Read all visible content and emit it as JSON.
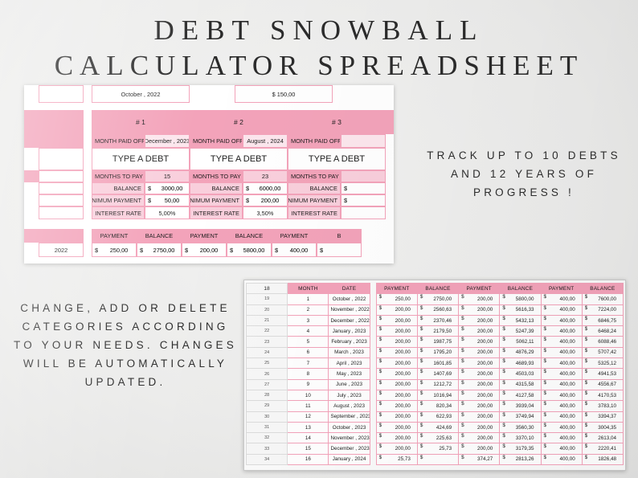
{
  "headline": {
    "line1": "DEBT SNOWBALL",
    "line2": "CALCULATOR SPREADSHEET"
  },
  "promo_right": "TRACK UP TO 10 DEBTS AND 12 YEARS OF PROGRESS !",
  "promo_left": "CHANGE, ADD OR DELETE CATEGORIES ACCORDING TO YOUR NEEDS. CHANGES WILL BE AUTOMATICALLY UPDATED.",
  "colors": {
    "pink": "#F3A3BA",
    "pink_light": "#F9CFDC",
    "pink_xlight": "#FCE6ED",
    "text": "#1D1D1D",
    "background": "#ECECEB"
  },
  "top_sheet": {
    "start_month": "October , 2022",
    "extra_payment": "$ 150,00",
    "debts": [
      {
        "number": "# 1",
        "month_paid_off_label": "MONTH PAID OFF",
        "month_paid_off": "December , 2023",
        "name": "TYPE A DEBT",
        "months_to_pay_off_label": "MONTHS TO PAY OFF",
        "months_to_pay_off": "15",
        "balance_label": "BALANCE",
        "balance": "3000,00",
        "minimum_payment_label": "MINIMUM PAYMENT",
        "minimum_payment": "50,00",
        "interest_rate_label": "INTEREST RATE",
        "interest_rate": "5,00%",
        "payment_header": "PAYMENT",
        "balance_header": "BALANCE",
        "first_payment": "250,00",
        "first_balance": "2750,00"
      },
      {
        "number": "# 2",
        "month_paid_off_label": "MONTH PAID OFF",
        "month_paid_off": "August , 2024",
        "name": "TYPE A DEBT",
        "months_to_pay_off_label": "MONTHS TO PAY OFF",
        "months_to_pay_off": "23",
        "balance_label": "BALANCE",
        "balance": "6000,00",
        "minimum_payment_label": "MINIMUM PAYMENT",
        "minimum_payment": "200,00",
        "interest_rate_label": "INTEREST RATE",
        "interest_rate": "3,50%",
        "payment_header": "PAYMENT",
        "balance_header": "BALANCE",
        "first_payment": "200,00",
        "first_balance": "5800,00"
      },
      {
        "number": "# 3",
        "month_paid_off_label": "MONTH PAID OFF",
        "month_paid_off": "",
        "name": "TYPE A DEBT",
        "months_to_pay_off_label": "MONTHS TO PAY OFF",
        "months_to_pay_off": "",
        "balance_label": "BALANCE",
        "balance": "",
        "minimum_payment_label": "MINIMUM PAYMENT",
        "minimum_payment": "",
        "interest_rate_label": "INTEREST RATE",
        "interest_rate": "",
        "payment_header": "PAYMENT",
        "balance_header": "B",
        "first_payment": "400,00",
        "first_balance": ""
      }
    ],
    "first_row_year": "2022",
    "dollar_sign": "$"
  },
  "bottom_sheet": {
    "dollar_sign": "$",
    "headers": {
      "row_num": "",
      "month": "MONTH",
      "date": "DATE",
      "payment": "PAYMENT",
      "balance": "BALANCE"
    },
    "column_groups": [
      "PAYMENT",
      "BALANCE",
      "PAYMENT",
      "BALANCE",
      "PAYMENT",
      "BALANCE"
    ],
    "header_row_num": "18",
    "rows": [
      {
        "rn": "19",
        "month": "1",
        "date": "October , 2022",
        "p1": "250,00",
        "b1": "2750,00",
        "p2": "200,00",
        "b2": "5800,00",
        "p3": "400,00",
        "b3": "7600,00"
      },
      {
        "rn": "20",
        "month": "2",
        "date": "November , 2022",
        "p1": "200,00",
        "b1": "2560,63",
        "p2": "200,00",
        "b2": "5616,33",
        "p3": "400,00",
        "b3": "7224,00"
      },
      {
        "rn": "21",
        "month": "3",
        "date": "December , 2022",
        "p1": "200,00",
        "b1": "2370,46",
        "p2": "200,00",
        "b2": "5432,13",
        "p3": "400,00",
        "b3": "6846,75"
      },
      {
        "rn": "22",
        "month": "4",
        "date": "January , 2023",
        "p1": "200,00",
        "b1": "2179,50",
        "p2": "200,00",
        "b2": "5247,39",
        "p3": "400,00",
        "b3": "6468,24"
      },
      {
        "rn": "23",
        "month": "5",
        "date": "February , 2023",
        "p1": "200,00",
        "b1": "1987,75",
        "p2": "200,00",
        "b2": "5062,11",
        "p3": "400,00",
        "b3": "6088,46"
      },
      {
        "rn": "24",
        "month": "6",
        "date": "March , 2023",
        "p1": "200,00",
        "b1": "1795,20",
        "p2": "200,00",
        "b2": "4876,29",
        "p3": "400,00",
        "b3": "5707,42"
      },
      {
        "rn": "25",
        "month": "7",
        "date": "April , 2023",
        "p1": "200,00",
        "b1": "1601,85",
        "p2": "200,00",
        "b2": "4689,93",
        "p3": "400,00",
        "b3": "5325,12"
      },
      {
        "rn": "26",
        "month": "8",
        "date": "May , 2023",
        "p1": "200,00",
        "b1": "1407,69",
        "p2": "200,00",
        "b2": "4503,03",
        "p3": "400,00",
        "b3": "4941,53"
      },
      {
        "rn": "27",
        "month": "9",
        "date": "June , 2023",
        "p1": "200,00",
        "b1": "1212,72",
        "p2": "200,00",
        "b2": "4315,58",
        "p3": "400,00",
        "b3": "4556,67"
      },
      {
        "rn": "28",
        "month": "10",
        "date": "July , 2023",
        "p1": "200,00",
        "b1": "1016,94",
        "p2": "200,00",
        "b2": "4127,58",
        "p3": "400,00",
        "b3": "4170,53"
      },
      {
        "rn": "29",
        "month": "11",
        "date": "August , 2023",
        "p1": "200,00",
        "b1": "820,34",
        "p2": "200,00",
        "b2": "3939,04",
        "p3": "400,00",
        "b3": "3783,10"
      },
      {
        "rn": "30",
        "month": "12",
        "date": "September , 2023",
        "p1": "200,00",
        "b1": "622,93",
        "p2": "200,00",
        "b2": "3749,94",
        "p3": "400,00",
        "b3": "3394,37"
      },
      {
        "rn": "31",
        "month": "13",
        "date": "October , 2023",
        "p1": "200,00",
        "b1": "424,69",
        "p2": "200,00",
        "b2": "3560,30",
        "p3": "400,00",
        "b3": "3004,35"
      },
      {
        "rn": "32",
        "month": "14",
        "date": "November , 2023",
        "p1": "200,00",
        "b1": "225,63",
        "p2": "200,00",
        "b2": "3370,10",
        "p3": "400,00",
        "b3": "2613,04"
      },
      {
        "rn": "33",
        "month": "15",
        "date": "December , 2023",
        "p1": "200,00",
        "b1": "25,73",
        "p2": "200,00",
        "b2": "3179,35",
        "p3": "400,00",
        "b3": "2220,41"
      },
      {
        "rn": "34",
        "month": "16",
        "date": "January , 2024",
        "p1": "25,73",
        "b1": "",
        "p2": "374,27",
        "b2": "2813,26",
        "p3": "400,00",
        "b3": "1826,48"
      }
    ]
  }
}
